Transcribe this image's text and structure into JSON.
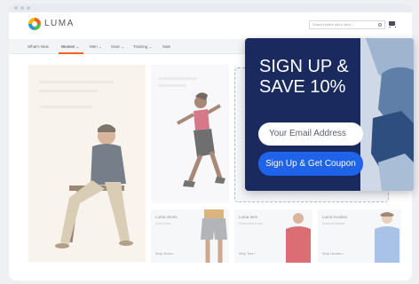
{
  "store": {
    "logo_text": "LUMA"
  },
  "search": {
    "placeholder": "Search entire store here..."
  },
  "nav": {
    "items": [
      {
        "label": "What's New"
      },
      {
        "label": "Women ⌄"
      },
      {
        "label": "Men ⌄"
      },
      {
        "label": "Gear ⌄"
      },
      {
        "label": "Training ⌄"
      },
      {
        "label": "Sale"
      }
    ]
  },
  "tiles": [
    {
      "title": "Luma shorts",
      "sub": "Cool it now",
      "link": "Shop Shorts ›"
    },
    {
      "title": "Luma tees",
      "sub": "Grab a tee or two",
      "link": "Shop Tees ›"
    },
    {
      "title": "Luma hoodies",
      "sub": "Dress for fitness",
      "link": "Shop Hoodies ›"
    }
  ],
  "popup": {
    "headline_line1": "SIGN UP &",
    "headline_line2": "SAVE 10%",
    "email_placeholder": "Your Email Address",
    "cta_label": "Sign Up & Get Coupon"
  },
  "colors": {
    "popup_bg": "#1a2a5e",
    "cta_bg": "#1e63e9",
    "nav_accent": "#f26322"
  }
}
